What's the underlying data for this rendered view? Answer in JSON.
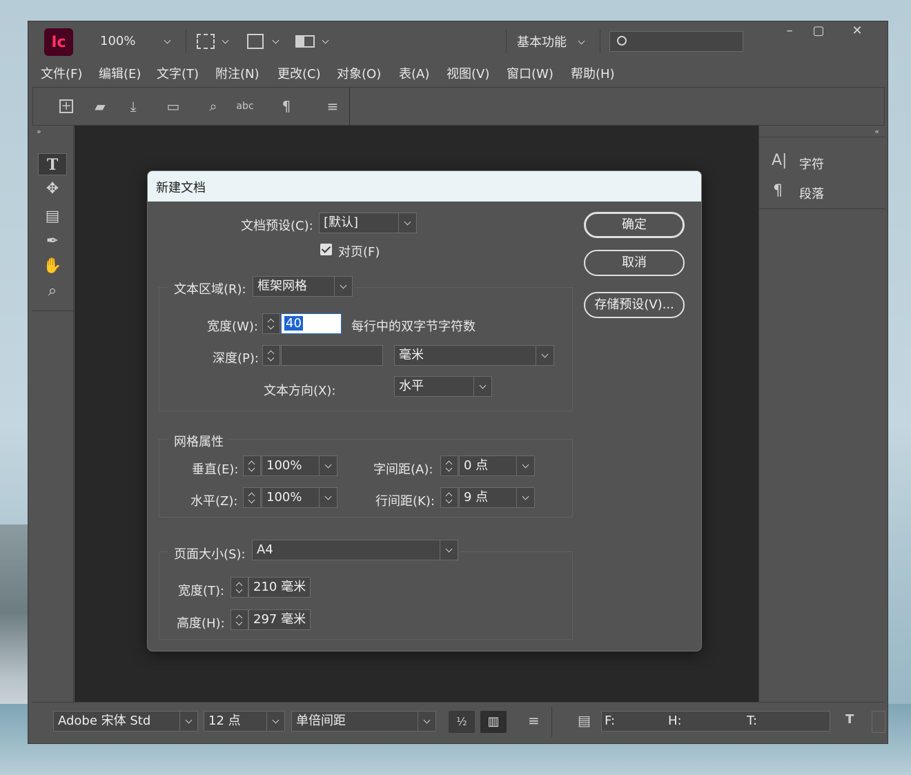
{
  "app": {
    "zoom": "100%",
    "workspace": "基本功能",
    "window_controls": [
      "–",
      "▢",
      "✕"
    ]
  },
  "menu": [
    "文件(F)",
    "编辑(E)",
    "文字(T)",
    "附注(N)",
    "更改(C)",
    "对象(O)",
    "表(A)",
    "视图(V)",
    "窗口(W)",
    "帮助(H)"
  ],
  "right_panel": {
    "items": [
      {
        "label": "字符",
        "icon": "character-icon"
      },
      {
        "label": "段落",
        "icon": "paragraph-icon"
      }
    ]
  },
  "status_bar": {
    "font": "Adobe 宋体 Std",
    "size": "12 点",
    "spacing": "单倍间距",
    "f_label": "F:",
    "h_label": "H:",
    "t_label": "T:"
  },
  "dialog": {
    "title": "新建文档",
    "preset_label": "文档预设(C):",
    "preset_value": "[默认]",
    "facing_label": "对页(F)",
    "facing_checked": true,
    "text_area_label": "文本区域(R):",
    "text_area_value": "框架网格",
    "width_label": "宽度(W):",
    "width_value": "40",
    "width_hint": "每行中的双字节字符数",
    "depth_label": "深度(P):",
    "depth_value": "",
    "depth_unit": "毫米",
    "direction_label": "文本方向(X):",
    "direction_value": "水平",
    "grid_title": "网格属性",
    "vertical_label": "垂直(E):",
    "vertical_value": "100%",
    "horizontal_label": "水平(Z):",
    "horizontal_value": "100%",
    "char_spacing_label": "字间距(A):",
    "char_spacing_value": "0 点",
    "line_spacing_label": "行间距(K):",
    "line_spacing_value": "9 点",
    "page_size_label": "页面大小(S):",
    "page_size_value": "A4",
    "page_width_label": "宽度(T):",
    "page_width_value": "210 毫米",
    "page_height_label": "高度(H):",
    "page_height_value": "297 毫米",
    "ok_label": "确定",
    "cancel_label": "取消",
    "save_preset_label": "存储预设(V)..."
  }
}
